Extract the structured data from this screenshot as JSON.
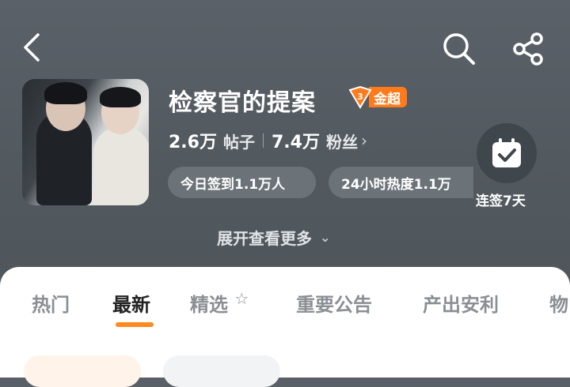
{
  "header": {
    "back_icon": "chevron-left-icon",
    "search_icon": "search-icon",
    "share_icon": "share-icon"
  },
  "forum": {
    "title": "检察官的提案",
    "badge_level": "3",
    "badge_label": "金超",
    "posts_count": "2.6万",
    "posts_label": "帖子",
    "fans_count": "7.4万",
    "fans_label": "粉丝",
    "checkin_today": "今日签到1.1万人",
    "heat_24h": "24小时热度1.1万",
    "expand_label": "展开查看更多",
    "checkin_streak": "连签7天"
  },
  "tabs": [
    {
      "label": "热门"
    },
    {
      "label": "最新"
    },
    {
      "label": "精选"
    },
    {
      "label": "重要公告"
    },
    {
      "label": "产出安利"
    },
    {
      "label": "物"
    }
  ],
  "colors": {
    "accent": "#ff8a1f",
    "badge": "#ff7a1a"
  }
}
